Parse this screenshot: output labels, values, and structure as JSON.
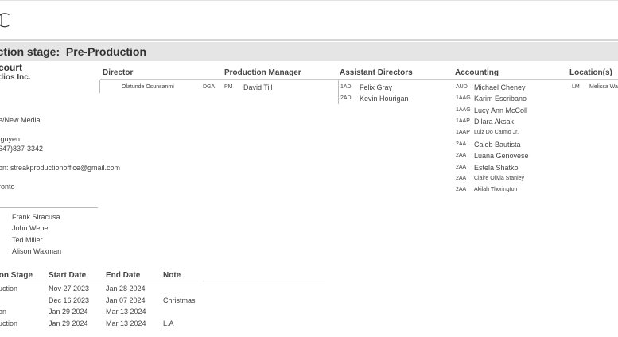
{
  "header": {
    "icon": "c-logo-glyph",
    "stage_label": "uction stage:",
    "stage_value": "Pre-Production"
  },
  "company": {
    "name": "court",
    "sub": "dios Inc.",
    "type": "e/New Media",
    "contact": "Iguyen",
    "phone": "647)837-3342",
    "email_line": "on: streakproductionoffice@gmail.com",
    "city": "ronto"
  },
  "people": [
    "Frank Siracusa",
    "John Weber",
    "Ted Miller",
    "Alison Waxman"
  ],
  "director": {
    "heading": "Director",
    "name": "Olatunde Osunsanmi",
    "union": "DGA",
    "role": "PM",
    "pm_name": "David Till"
  },
  "production_manager": {
    "heading": "Production Manager"
  },
  "assistant_directors": {
    "heading": "Assistant Directors",
    "rows": [
      {
        "code": "1AD",
        "name": "Felix Gray"
      },
      {
        "code": "2AD",
        "name": "Kevin Hourigan"
      }
    ]
  },
  "accounting": {
    "heading": "Accounting",
    "rows": [
      {
        "code": "AUD",
        "name": "Michael Cheney"
      },
      {
        "code": "1AAG",
        "name": "Karim Escribano"
      },
      {
        "code": "1AAG",
        "name": "Lucy Ann McColl"
      },
      {
        "code": "1AAP",
        "name": "Dilara Aksak"
      },
      {
        "code": "1AAP",
        "name": "Luiz Do Carmo Jr."
      },
      {
        "code": "2AA",
        "name": "Caleb Bautista"
      },
      {
        "code": "2AA",
        "name": "Luana Genovese"
      },
      {
        "code": "2AA",
        "name": "Estela Shatko"
      },
      {
        "code": "2AA",
        "name": "Claire Olivia Stanley"
      },
      {
        "code": "2AA",
        "name": "Akilah Thorington"
      }
    ]
  },
  "locations": {
    "heading": "Location(s)",
    "code": "LM",
    "name": "Melissa Wa"
  },
  "stages_table": {
    "headers": [
      "ion Stage",
      "Start Date",
      "End Date",
      "Note"
    ],
    "rows": [
      {
        "stage": "uction",
        "start": "Nov 27 2023",
        "end": "Jan 28 2024",
        "note": ""
      },
      {
        "stage": "",
        "start": "Dec 16 2023",
        "end": "Jan 07 2024",
        "note": "Christmas"
      },
      {
        "stage": "on",
        "start": "Jan 29 2024",
        "end": "Mar 13 2024",
        "note": ""
      },
      {
        "stage": "uction",
        "start": "Jan 29 2024",
        "end": "Mar 13 2024",
        "note": "L.A"
      }
    ]
  }
}
